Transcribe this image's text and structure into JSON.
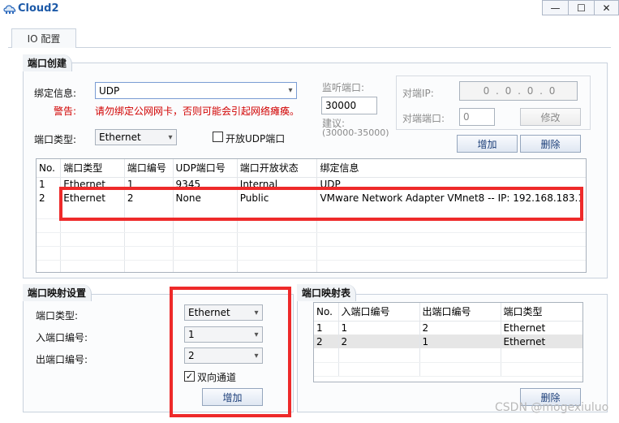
{
  "window": {
    "title": "Cloud2",
    "min_glyph": "—",
    "max_glyph": "☐",
    "close_glyph": "✕"
  },
  "tab": {
    "label": "IO 配置"
  },
  "port_create": {
    "group_title": "端口创建",
    "bind_label": "绑定信息:",
    "bind_value": "UDP",
    "warning_label": "警告:",
    "warning_text": "请勿绑定公网网卡，否则可能会引起网络瘫痪。",
    "port_type_label": "端口类型:",
    "port_type_value": "Ethernet",
    "open_udp_label": "开放UDP端口",
    "listen_label": "监听端口:",
    "listen_value": "30000",
    "suggest_label": "建议:",
    "suggest_range": "(30000-35000)",
    "peer_ip_label": "对端IP:",
    "peer_ip_value": "0 . 0 . 0 . 0",
    "peer_port_label": "对端端口:",
    "peer_port_value": "0",
    "modify_button": "修改",
    "add_button": "增加",
    "delete_button": "删除",
    "table": {
      "headers": [
        "No.",
        "端口类型",
        "端口编号",
        "UDP端口号",
        "端口开放状态",
        "绑定信息"
      ],
      "rows": [
        [
          "1",
          "Ethernet",
          "1",
          "9345",
          "Internal",
          "UDP"
        ],
        [
          "2",
          "Ethernet",
          "2",
          "None",
          "Public",
          "VMware Network Adapter VMnet8 -- IP: 192.168.183.1"
        ]
      ]
    }
  },
  "port_map_settings": {
    "group_title": "端口映射设置",
    "port_type_label": "端口类型:",
    "port_type_value": "Ethernet",
    "in_port_label": "入端口编号:",
    "in_port_value": "1",
    "out_port_label": "出端口编号:",
    "out_port_value": "2",
    "bidirectional_label": "双向通道",
    "bidirectional_checked": "✓",
    "add_button": "增加"
  },
  "port_map_table": {
    "group_title": "端口映射表",
    "headers": [
      "No.",
      "入端口编号",
      "出端口编号",
      "端口类型"
    ],
    "rows": [
      [
        "1",
        "1",
        "2",
        "Ethernet"
      ],
      [
        "2",
        "2",
        "1",
        "Ethernet"
      ]
    ],
    "delete_button": "删除"
  },
  "watermark": "CSDN @mogexiuluo",
  "colors": {
    "accent_red": "#ee2a2a",
    "title_blue": "#1d5aa8",
    "warning_red": "#d10000"
  }
}
